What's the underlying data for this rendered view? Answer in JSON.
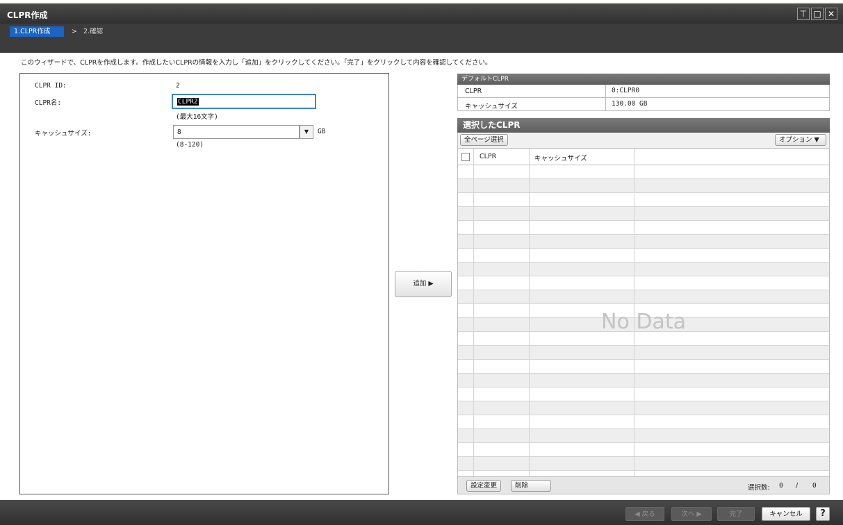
{
  "window": {
    "title": "CLPR作成",
    "controls": [
      "pin-icon",
      "maximize-icon",
      "close-icon"
    ]
  },
  "steps": {
    "active": "1.CLPR作成",
    "separator": ">",
    "next": "2.確認"
  },
  "description": "このウィザードで、CLPRを作成します。作成したいCLPRの情報を入力し「追加」をクリックしてください。「完了」をクリックして内容を確認してください。",
  "form": {
    "id_label": "CLPR ID:",
    "id_value": "2",
    "name_label": "CLPR名:",
    "name_value": "CLPR2",
    "name_hint": "(最大16文字)",
    "cache_label": "キャッシュサイズ:",
    "cache_value": "8",
    "cache_unit": "GB",
    "cache_hint": "(8-120)"
  },
  "add_button": "追加 ▶",
  "default_clpr": {
    "header": "デフォルトCLPR",
    "rows": [
      {
        "key": "CLPR",
        "value": "0:CLPR0"
      },
      {
        "key": "キャッシュサイズ",
        "value": "130.00 GB"
      }
    ]
  },
  "selected_clpr": {
    "header": "選択したCLPR",
    "select_all": "全ページ選択",
    "options": "オプション ▼",
    "columns": [
      "CLPR",
      "キャッシュサイズ"
    ],
    "empty_text": "No Data",
    "edit_button": "設定変更",
    "delete_button": "削除",
    "count_label": "選択数:",
    "count_value": "0",
    "count_sep": "/",
    "count_total": "0"
  },
  "footer": {
    "back": "◀ 戻る",
    "next": "次へ ▶",
    "finish": "完了",
    "cancel": "キャンセル",
    "help": "?"
  },
  "colors": {
    "accent_green": "#7bb42d",
    "step_blue": "#1a64c4",
    "focus_blue": "#3c86c8"
  }
}
